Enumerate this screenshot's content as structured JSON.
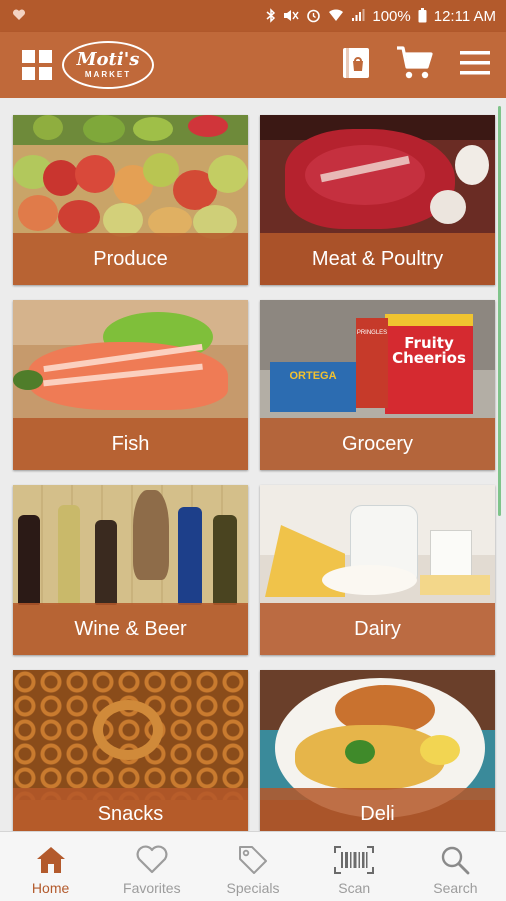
{
  "status_bar": {
    "battery": "100%",
    "time": "12:11 AM"
  },
  "header": {
    "logo_line1": "Moti's",
    "logo_line2": "MARKET"
  },
  "categories": [
    {
      "label": "Produce"
    },
    {
      "label": "Meat & Poultry"
    },
    {
      "label": "Fish"
    },
    {
      "label": "Grocery"
    },
    {
      "label": "Wine & Beer"
    },
    {
      "label": "Dairy"
    },
    {
      "label": "Snacks"
    },
    {
      "label": "Deli"
    }
  ],
  "grocery_products": {
    "box1": "Fruity Cheerios",
    "box2": "ORTEGA",
    "box3": "PRINGLES"
  },
  "bottom_nav": [
    {
      "label": "Home",
      "icon": "home-icon",
      "active": true
    },
    {
      "label": "Favorites",
      "icon": "heart-icon"
    },
    {
      "label": "Specials",
      "icon": "tag-icon"
    },
    {
      "label": "Scan",
      "icon": "barcode-icon"
    },
    {
      "label": "Search",
      "icon": "search-icon"
    }
  ],
  "colors": {
    "brand": "#c0693a",
    "status_bar": "#b35a2c",
    "label_overlay": "#b4582a",
    "nav_active": "#b35a2c",
    "nav_inactive": "#9c9c9c"
  }
}
